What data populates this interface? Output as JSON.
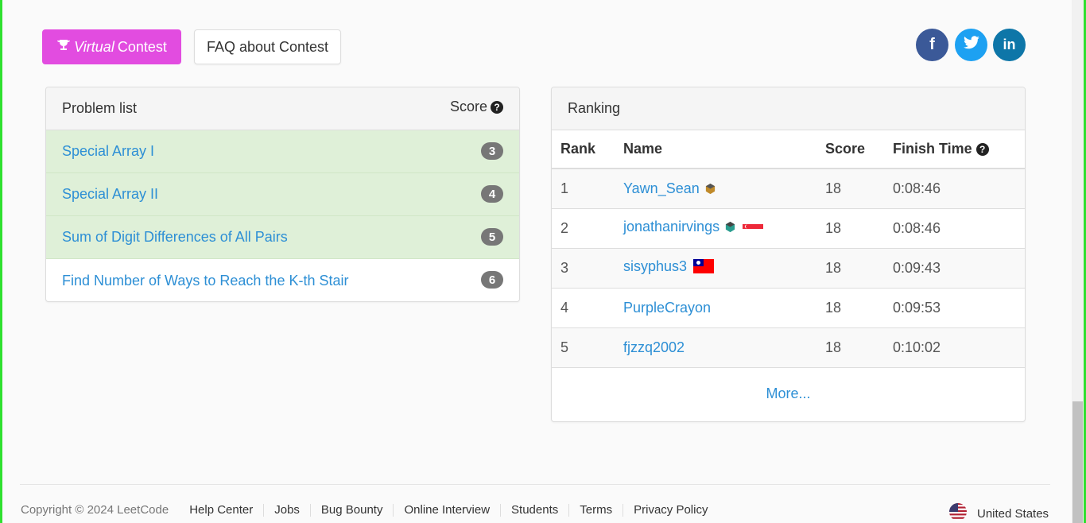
{
  "toolbar": {
    "virtual_italic": "Virtual",
    "virtual_label": "Contest",
    "faq_label": "FAQ about Contest"
  },
  "social": {
    "facebook": "f",
    "twitter": "🐦",
    "linkedin": "in"
  },
  "problems": {
    "title": "Problem list",
    "score_label": "Score",
    "items": [
      {
        "name": "Special Array I",
        "score": "3",
        "solved": true
      },
      {
        "name": "Special Array II",
        "score": "4",
        "solved": true
      },
      {
        "name": "Sum of Digit Differences of All Pairs",
        "score": "5",
        "solved": true
      },
      {
        "name": "Find Number of Ways to Reach the K-th Stair",
        "score": "6",
        "solved": false
      }
    ]
  },
  "ranking": {
    "title": "Ranking",
    "columns": [
      "Rank",
      "Name",
      "Score",
      "Finish Time"
    ],
    "rows": [
      {
        "rank": "1",
        "name": "Yawn_Sean",
        "score": "18",
        "time": "0:08:46",
        "badge": "knight-hex",
        "flag": ""
      },
      {
        "rank": "2",
        "name": "jonathanirvings",
        "score": "18",
        "time": "0:08:46",
        "badge": "guardian-hex",
        "flag": "singapore"
      },
      {
        "rank": "3",
        "name": "sisyphus3",
        "score": "18",
        "time": "0:09:43",
        "badge": "",
        "flag": "taiwan"
      },
      {
        "rank": "4",
        "name": "PurpleCrayon",
        "score": "18",
        "time": "0:09:53",
        "badge": "",
        "flag": ""
      },
      {
        "rank": "5",
        "name": "fjzzq2002",
        "score": "18",
        "time": "0:10:02",
        "badge": "",
        "flag": ""
      }
    ],
    "more_label": "More..."
  },
  "footer": {
    "copyright": "Copyright © 2024 LeetCode",
    "links": [
      "Help Center",
      "Jobs",
      "Bug Bounty",
      "Online Interview",
      "Students",
      "Terms",
      "Privacy Policy"
    ],
    "locale": "United States"
  },
  "colors": {
    "virtual_button": "#e24ce0",
    "link": "#2d8fd5",
    "solved_row": "#dff0d8",
    "badge": "#777777"
  }
}
